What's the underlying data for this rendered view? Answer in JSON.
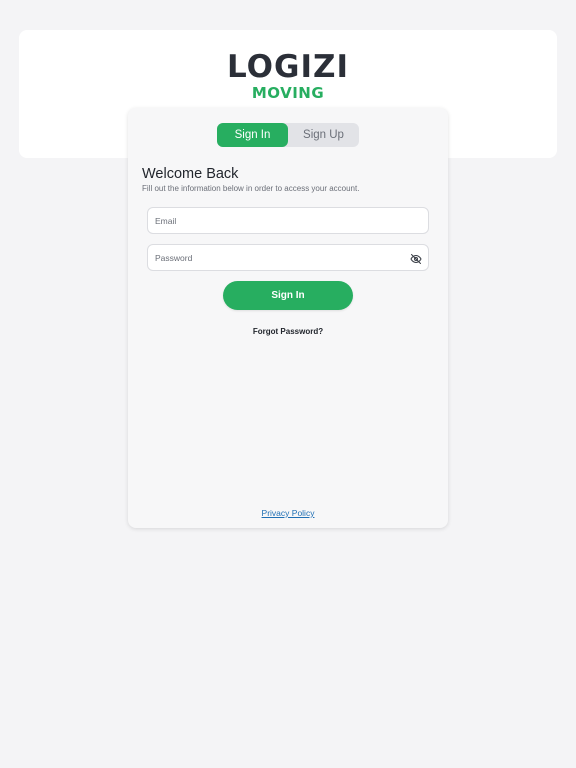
{
  "header": {
    "logo_text": "LOGIZI",
    "logo_subtext": "MOVING"
  },
  "auth": {
    "tabs": [
      {
        "label": "Sign In",
        "active": true
      },
      {
        "label": "Sign Up",
        "active": false
      }
    ],
    "title": "Welcome Back",
    "subtitle": "Fill out the information below in order to access your account.",
    "email": {
      "placeholder": "Email",
      "value": ""
    },
    "password": {
      "placeholder": "Password",
      "value": "",
      "toggle_icon": "eye-off-icon"
    },
    "submit_label": "Sign In",
    "forgot_label": "Forgot Password?",
    "privacy_label": "Privacy Policy"
  },
  "colors": {
    "accent": "#27ae60",
    "background": "#f4f4f6",
    "link": "#1f6fb4"
  }
}
